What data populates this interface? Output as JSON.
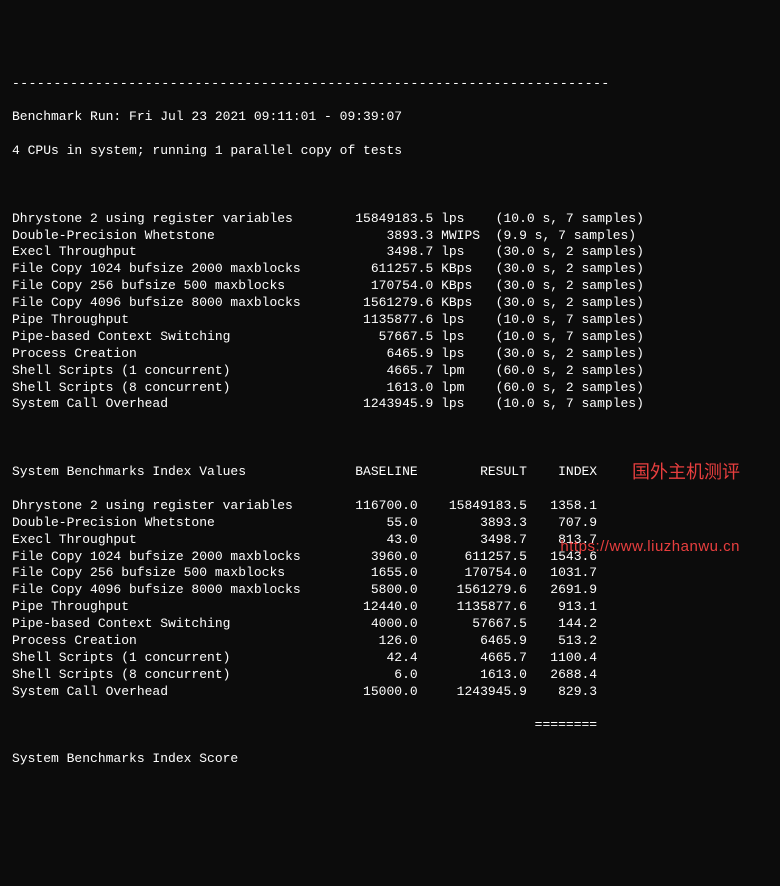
{
  "header": {
    "run_line": "Benchmark Run: Fri Jul 23 2021 09:11:01 - 09:39:07",
    "cpu_line": "4 CPUs in system; running 1 parallel copy of tests"
  },
  "divider_top": "------------------------------------------------------------------------",
  "results": [
    {
      "name": "Dhrystone 2 using register variables",
      "value": "15849183.5",
      "unit": "lps",
      "timing": "(10.0 s, 7 samples)"
    },
    {
      "name": "Double-Precision Whetstone",
      "value": "3893.3",
      "unit": "MWIPS",
      "timing": "(9.9 s, 7 samples)"
    },
    {
      "name": "Execl Throughput",
      "value": "3498.7",
      "unit": "lps",
      "timing": "(30.0 s, 2 samples)"
    },
    {
      "name": "File Copy 1024 bufsize 2000 maxblocks",
      "value": "611257.5",
      "unit": "KBps",
      "timing": "(30.0 s, 2 samples)"
    },
    {
      "name": "File Copy 256 bufsize 500 maxblocks",
      "value": "170754.0",
      "unit": "KBps",
      "timing": "(30.0 s, 2 samples)"
    },
    {
      "name": "File Copy 4096 bufsize 8000 maxblocks",
      "value": "1561279.6",
      "unit": "KBps",
      "timing": "(30.0 s, 2 samples)"
    },
    {
      "name": "Pipe Throughput",
      "value": "1135877.6",
      "unit": "lps",
      "timing": "(10.0 s, 7 samples)"
    },
    {
      "name": "Pipe-based Context Switching",
      "value": "57667.5",
      "unit": "lps",
      "timing": "(10.0 s, 7 samples)"
    },
    {
      "name": "Process Creation",
      "value": "6465.9",
      "unit": "lps",
      "timing": "(30.0 s, 2 samples)"
    },
    {
      "name": "Shell Scripts (1 concurrent)",
      "value": "4665.7",
      "unit": "lpm",
      "timing": "(60.0 s, 2 samples)"
    },
    {
      "name": "Shell Scripts (8 concurrent)",
      "value": "1613.0",
      "unit": "lpm",
      "timing": "(60.0 s, 2 samples)"
    },
    {
      "name": "System Call Overhead",
      "value": "1243945.9",
      "unit": "lps",
      "timing": "(10.0 s, 7 samples)"
    }
  ],
  "index_header": {
    "title": "System Benchmarks Index Values",
    "col_baseline": "BASELINE",
    "col_result": "RESULT",
    "col_index": "INDEX"
  },
  "index_rows": [
    {
      "name": "Dhrystone 2 using register variables",
      "baseline": "116700.0",
      "result": "15849183.5",
      "index": "1358.1"
    },
    {
      "name": "Double-Precision Whetstone",
      "baseline": "55.0",
      "result": "3893.3",
      "index": "707.9"
    },
    {
      "name": "Execl Throughput",
      "baseline": "43.0",
      "result": "3498.7",
      "index": "813.7"
    },
    {
      "name": "File Copy 1024 bufsize 2000 maxblocks",
      "baseline": "3960.0",
      "result": "611257.5",
      "index": "1543.6"
    },
    {
      "name": "File Copy 256 bufsize 500 maxblocks",
      "baseline": "1655.0",
      "result": "170754.0",
      "index": "1031.7"
    },
    {
      "name": "File Copy 4096 bufsize 8000 maxblocks",
      "baseline": "5800.0",
      "result": "1561279.6",
      "index": "2691.9"
    },
    {
      "name": "Pipe Throughput",
      "baseline": "12440.0",
      "result": "1135877.6",
      "index": "913.1"
    },
    {
      "name": "Pipe-based Context Switching",
      "baseline": "4000.0",
      "result": "57667.5",
      "index": "144.2"
    },
    {
      "name": "Process Creation",
      "baseline": "126.0",
      "result": "6465.9",
      "index": "513.2"
    },
    {
      "name": "Shell Scripts (1 concurrent)",
      "baseline": "42.4",
      "result": "4665.7",
      "index": "1100.4"
    },
    {
      "name": "Shell Scripts (8 concurrent)",
      "baseline": "6.0",
      "result": "1613.0",
      "index": "2688.4"
    },
    {
      "name": "System Call Overhead",
      "baseline": "15000.0",
      "result": "1243945.9",
      "index": "829.3"
    }
  ],
  "score": {
    "label": "System Benchmarks Index Score"
  },
  "divider_mid": "                                                                   ========",
  "watermark": {
    "text": "国外主机测评",
    "url": "https://www.liuzhanwu.cn"
  }
}
